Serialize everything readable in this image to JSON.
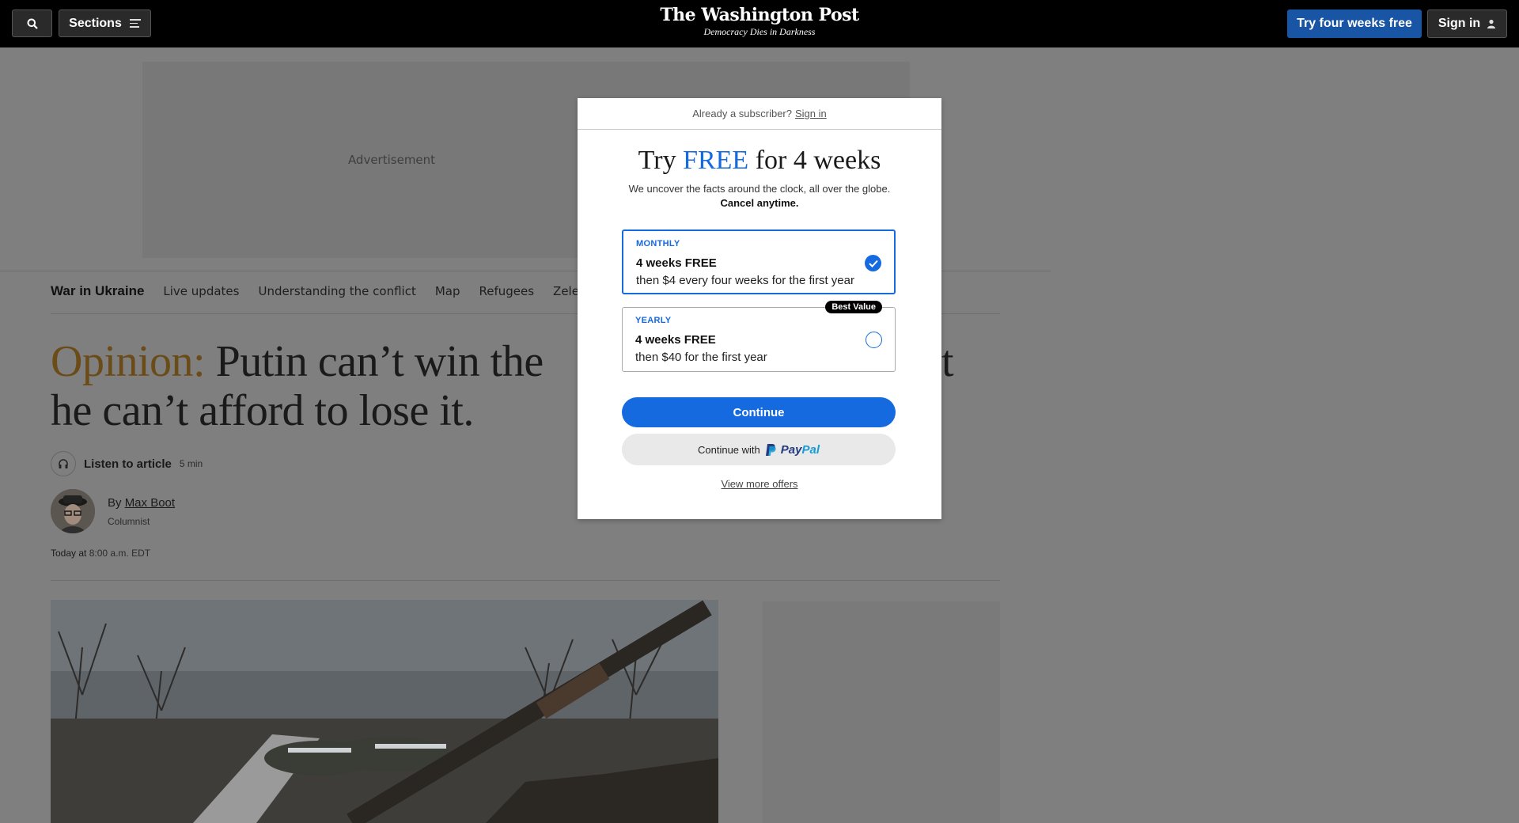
{
  "header": {
    "sections_label": "Sections",
    "logo": "The Washington Post",
    "tagline": "Democracy Dies in Darkness",
    "try_label": "Try four weeks free",
    "signin_label": "Sign in"
  },
  "ad": {
    "label": "Advertisement"
  },
  "subnav": {
    "title": "War in Ukraine",
    "items": [
      "Live updates",
      "Understanding the conflict",
      "Map",
      "Refugees",
      "Zelensky"
    ]
  },
  "article": {
    "kicker": "Opinion:",
    "headline_line1": "Putin can’t win the",
    "headline_tail": "t",
    "headline_line2": "he can’t afford to lose it.",
    "listen_label": "Listen to article",
    "listen_time": "5 min",
    "by": "By",
    "author": "Max Boot",
    "author_role": "Columnist",
    "date_prefix": "Today at",
    "date_time": "8:00 a.m. EDT"
  },
  "modal": {
    "already": "Already a subscriber?",
    "signin": "Sign in",
    "title_pre": "Try",
    "title_free": "FREE",
    "title_post": "for 4 weeks",
    "sub": "We uncover the facts around the clock, all over the globe.",
    "sub_bold": "Cancel anytime.",
    "plans": [
      {
        "type": "MONTHLY",
        "head": "4 weeks FREE",
        "desc": "then $4 every four weeks for the first year",
        "selected": true
      },
      {
        "type": "YEARLY",
        "head": "4 weeks FREE",
        "desc": "then $40 for the first year",
        "selected": false,
        "badge": "Best Value"
      }
    ],
    "continue": "Continue",
    "paypal_prefix": "Continue with",
    "paypal_brand_a": "Pay",
    "paypal_brand_b": "Pal",
    "more": "View more offers"
  },
  "colors": {
    "accent": "#166ae0",
    "header_bg": "#000000",
    "try_btn": "#1955a5",
    "opinion": "#6b4b17"
  }
}
